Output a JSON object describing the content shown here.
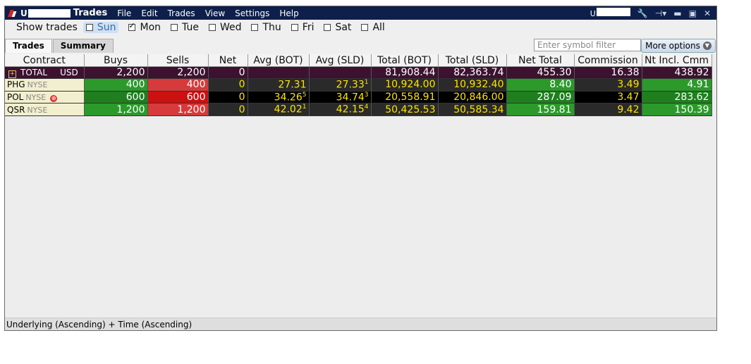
{
  "titlebar": {
    "account_prefix": "U",
    "title": "Trades",
    "menu": [
      "File",
      "Edit",
      "Trades",
      "View",
      "Settings",
      "Help"
    ],
    "account_right_prefix": "U"
  },
  "days": {
    "label": "Show trades",
    "items": [
      {
        "label": "Sun",
        "checked": false
      },
      {
        "label": "Mon",
        "checked": true
      },
      {
        "label": "Tue",
        "checked": false
      },
      {
        "label": "Wed",
        "checked": false
      },
      {
        "label": "Thu",
        "checked": false
      },
      {
        "label": "Fri",
        "checked": false
      },
      {
        "label": "Sat",
        "checked": false
      },
      {
        "label": "All",
        "checked": false
      }
    ]
  },
  "tabs": [
    "Trades",
    "Summary"
  ],
  "filter_placeholder": "Enter symbol filter",
  "more_options": "More options",
  "columns": [
    "Contract",
    "Buys",
    "Sells",
    "Net",
    "Avg (BOT)",
    "Avg (SLD)",
    "Total (BOT)",
    "Total (SLD)",
    "Net Total",
    "Commission",
    "Nt Incl. Cmm"
  ],
  "total_row": {
    "label": "TOTAL",
    "currency": "USD",
    "buys": "2,200",
    "sells": "2,200",
    "net": "0",
    "total_bot": "81,908.44",
    "total_sld": "82,363.74",
    "net_total": "455.30",
    "commission": "16.38",
    "nt_incl": "438.92"
  },
  "rows": [
    {
      "symbol": "PHG",
      "exchange": "NYSE",
      "buys": "400",
      "sells": "400",
      "net": "0",
      "avg_bot": "27.31",
      "avg_bot_sup": "",
      "avg_sld": "27.33",
      "avg_sld_sup": "1",
      "total_bot": "10,924.00",
      "total_sld": "10,932.40",
      "net_total": "8.40",
      "commission": "3.49",
      "nt_incl": "4.91"
    },
    {
      "symbol": "POL",
      "exchange": "NYSE",
      "buys": "600",
      "sells": "600",
      "net": "0",
      "avg_bot": "34.26",
      "avg_bot_sup": "5",
      "avg_sld": "34.74",
      "avg_sld_sup": "3",
      "total_bot": "20,558.91",
      "total_sld": "20,846.00",
      "net_total": "287.09",
      "commission": "3.47",
      "nt_incl": "283.62"
    },
    {
      "symbol": "QSR",
      "exchange": "NYSE",
      "buys": "1,200",
      "sells": "1,200",
      "net": "0",
      "avg_bot": "42.02",
      "avg_bot_sup": "1",
      "avg_sld": "42.15",
      "avg_sld_sup": "4",
      "total_bot": "50,425.53",
      "total_sld": "50,585.34",
      "net_total": "159.81",
      "commission": "9.42",
      "nt_incl": "150.39"
    }
  ],
  "status": "Underlying (Ascending)  +  Time (Ascending)"
}
